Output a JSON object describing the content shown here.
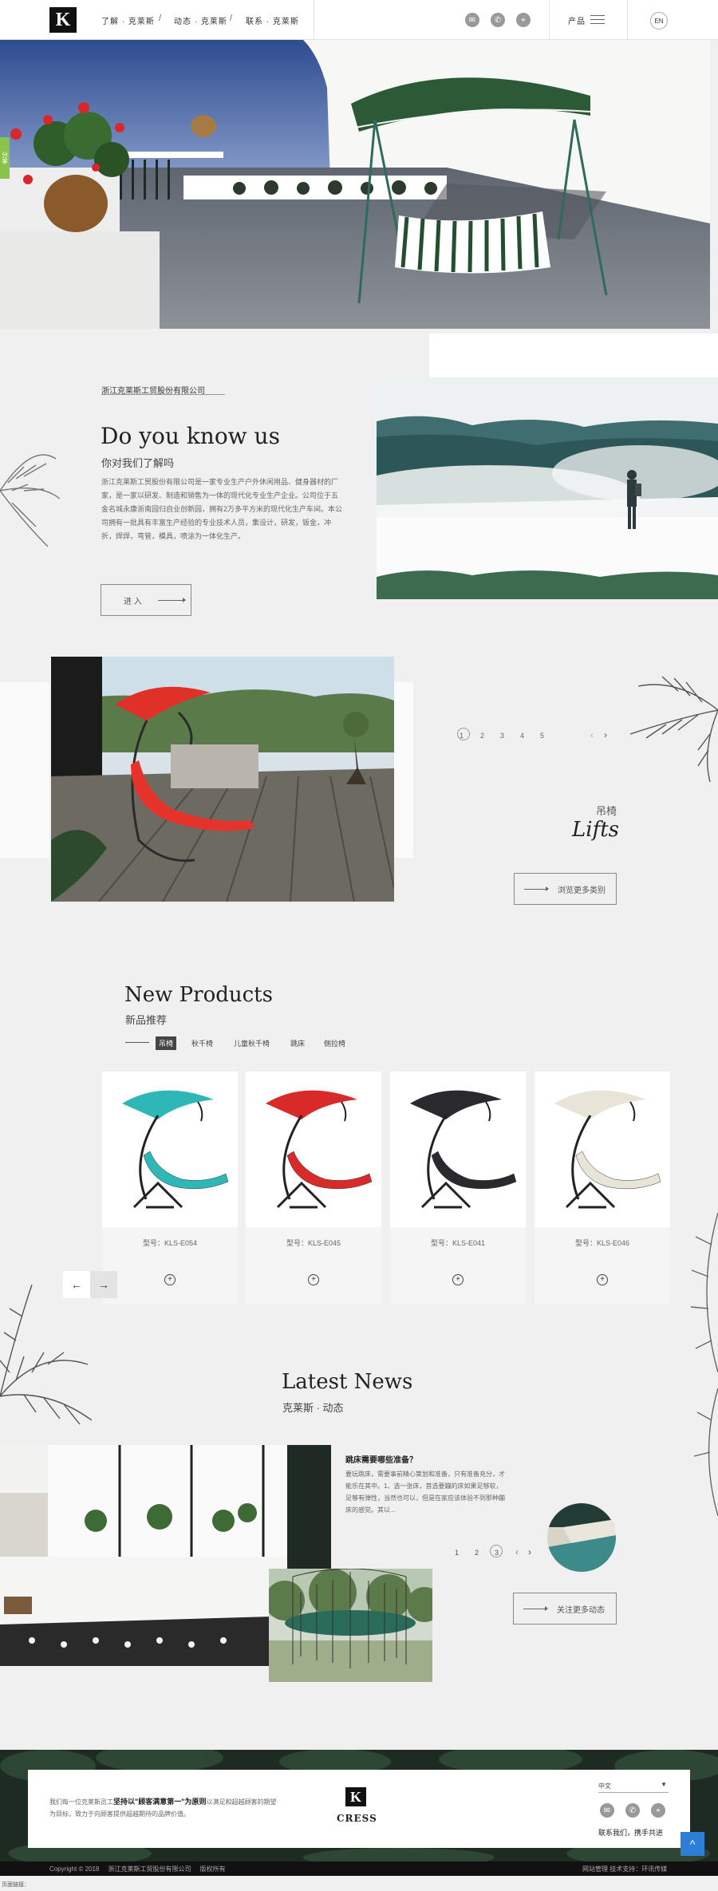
{
  "header": {
    "logo_letter": "K",
    "nav": [
      "了解 · 克莱斯",
      "动态 · 克莱斯",
      "联系 · 克莱斯"
    ],
    "separator": "/",
    "icons": [
      "mail-icon",
      "phone-icon",
      "location-icon"
    ],
    "products_label": "产品",
    "lang_label": "EN"
  },
  "hero": {
    "share_label": "分享"
  },
  "about": {
    "company": "浙江克莱斯工贸股份有限公司",
    "title_en": "Do you know us",
    "title_cn": "你对我们了解吗",
    "body": "浙江克莱斯工贸股份有限公司是一家专业生产户外休闲用品、健身器材的厂家，是一家以研发、制造和销售为一体的现代化专业生产企业。公司位于五金名城永康浙南园归自业创新园，拥有2万多平方米的现代化生产车间。本公司拥有一批具有丰富生产经验的专业技术人员，集设计，研发，钣金，冲折，焊焊，弯管，模具，喷涂为一体化生产。",
    "enter_label": "进 入"
  },
  "featured": {
    "pages": [
      "1",
      "2",
      "3",
      "4",
      "5"
    ],
    "prev": "‹",
    "next": "›",
    "cn": "吊椅",
    "en": "Lifts",
    "more_label": "浏览更多类别"
  },
  "products": {
    "title_en": "New Products",
    "title_cn": "新品推荐",
    "tabs": [
      "吊椅",
      "秋千椅",
      "儿童秋千椅",
      "跳床",
      "侧拉椅"
    ],
    "items": [
      {
        "model": "型号：KLS-E054",
        "color": "#2fb7b8"
      },
      {
        "model": "型号：KLS-E045",
        "color": "#d92a2a"
      },
      {
        "model": "型号：KLS-E041",
        "color": "#2a2a2e"
      },
      {
        "model": "型号：KLS-E046",
        "color": "#e8e4d8"
      }
    ],
    "plus": "+",
    "prev": "←",
    "next": "→"
  },
  "news": {
    "title_en": "Latest News",
    "title_cn": "克莱斯 · 动态",
    "headline": "跳床需要哪些准备？",
    "body": "要玩跳床，需要事前精心策划和准备，只有准备充分，才能乐在其中。1、选一张床，首选要蹦的床如果足够软，足够有弹性，当然也可以，但是在家应该体验不到那种蹦床的感觉。其以...",
    "pages": [
      "1",
      "2",
      "3"
    ],
    "prev": "‹",
    "next": "›",
    "more_label": "关注更多动态"
  },
  "footer": {
    "slogan_pre": "我们每一位克莱斯员工",
    "slogan_bold": "坚持以\"顾客满意第一\"为原则",
    "slogan_post": "以满足和超越顾客的期望为目标，致力于向顾客提供超越期待的品牌价值。",
    "brand": "CRESS",
    "lang_select": "中文",
    "contact_label": "联系我们，携手共进",
    "copyright": "Copyright © 2018     浙江克莱斯工贸股份有限公司     版权所有",
    "right_links": "网站管理 技术支持：环讯传媒",
    "tiny_text": "页面链接：",
    "top_icon": "^"
  }
}
